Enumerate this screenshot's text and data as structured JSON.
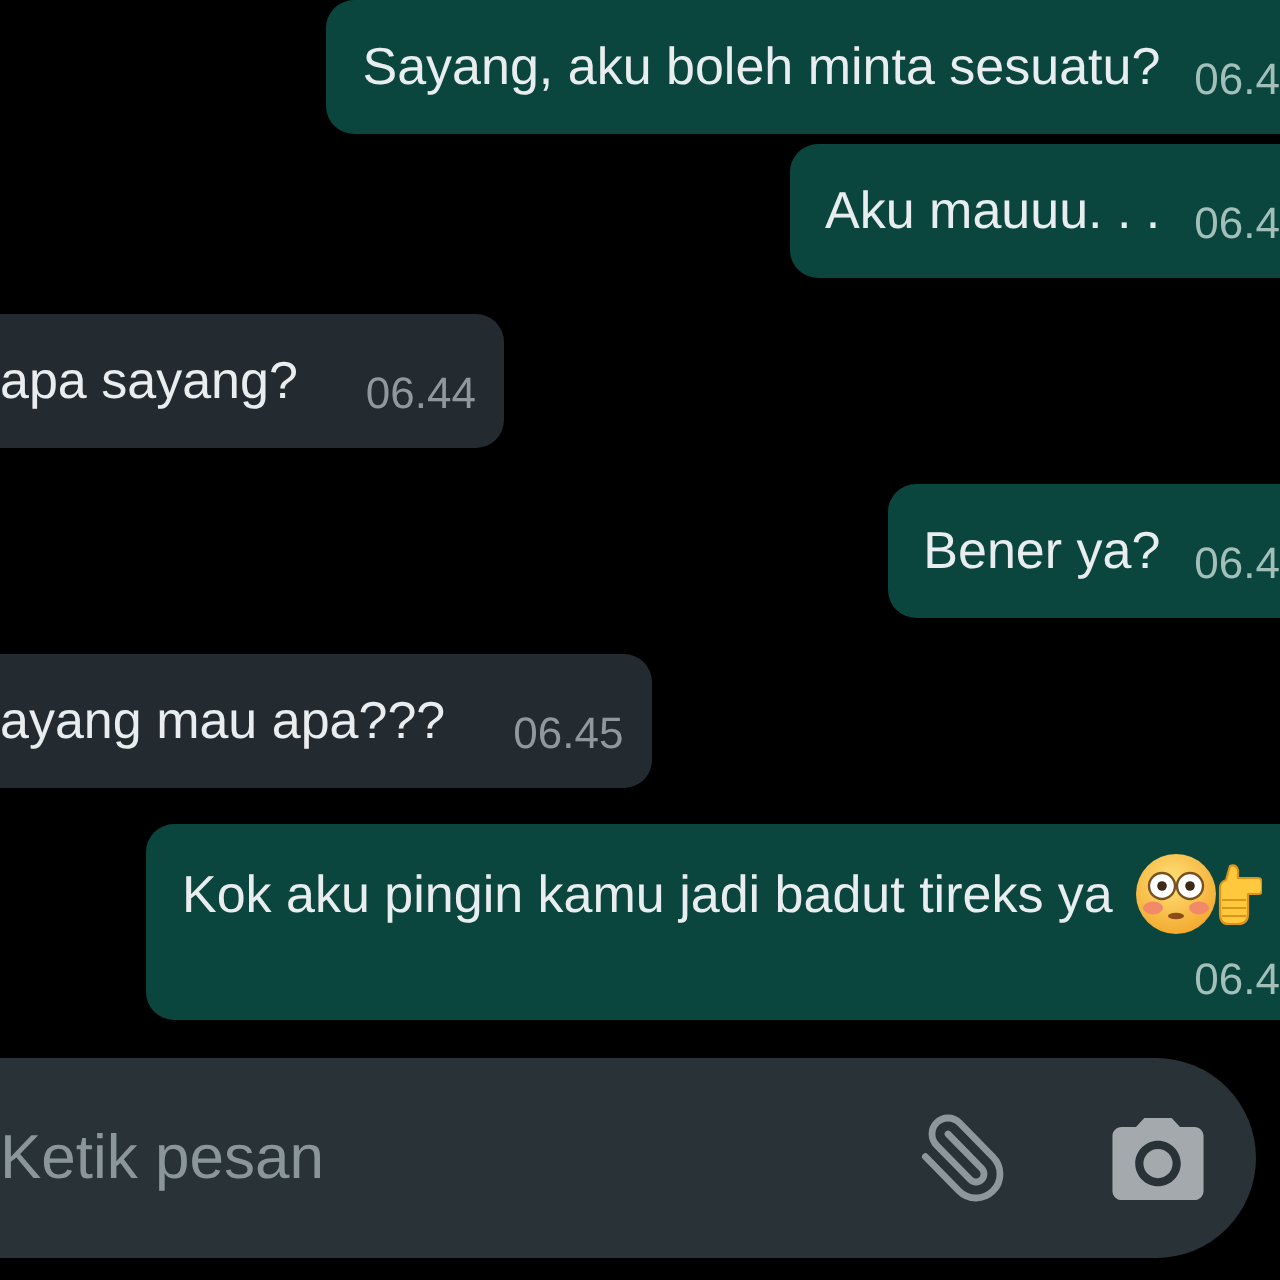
{
  "messages": [
    {
      "outgoing": true,
      "kind": "plain",
      "text": "Sayang, aku boleh minta sesuatu?",
      "time": "06.4"
    },
    {
      "outgoing": true,
      "kind": "plain",
      "text": "Aku mauuu. . .",
      "time": "06.4"
    },
    {
      "outgoing": false,
      "kind": "plain",
      "text": "apa sayang?",
      "time": "06.44"
    },
    {
      "outgoing": true,
      "kind": "plain",
      "text": "Bener ya?",
      "time": "06.4"
    },
    {
      "outgoing": false,
      "kind": "plain",
      "text": "ayang mau apa???",
      "time": "06.45"
    },
    {
      "outgoing": true,
      "kind": "emoji",
      "text": "Kok aku pingin kamu jadi badut tireks ya",
      "time": "06.4"
    }
  ],
  "composer": {
    "placeholder": "Ketik pesan"
  }
}
